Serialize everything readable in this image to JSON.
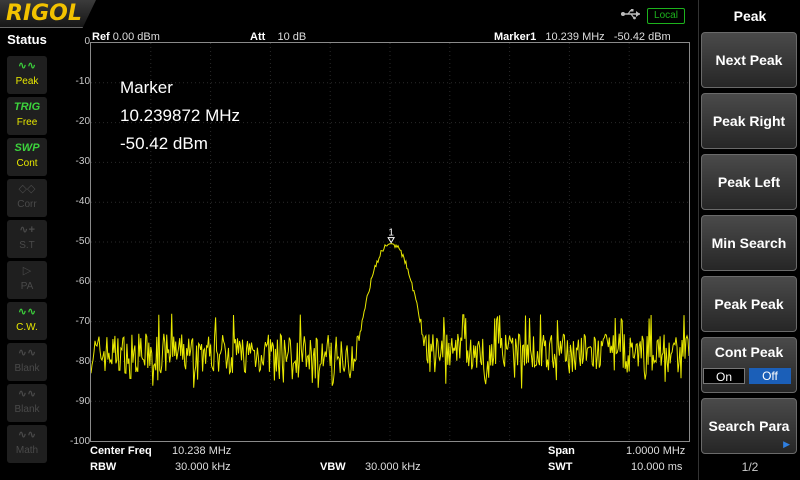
{
  "brand": "RIGOL",
  "top": {
    "local_label": "Local"
  },
  "status": {
    "title": "Status",
    "items": [
      {
        "glyph": "∿∿",
        "label": "Peak",
        "state": "on",
        "icon": "peak-icon"
      },
      {
        "glyph": "TRIG",
        "label": "Free",
        "state": "on",
        "icon": "trig-icon"
      },
      {
        "glyph": "SWP",
        "label": "Cont",
        "state": "on",
        "icon": "sweep-icon"
      },
      {
        "glyph": "◇◇",
        "label": "Corr",
        "state": "off",
        "icon": "correction-icon"
      },
      {
        "glyph": "∿+",
        "label": "S.T",
        "state": "off",
        "icon": "source-tracking-icon"
      },
      {
        "glyph": "▷",
        "label": "PA",
        "state": "off",
        "icon": "preamp-icon"
      },
      {
        "glyph": "∿∿",
        "label": "C.W.",
        "state": "on",
        "icon": "cw-icon"
      },
      {
        "glyph": "∿∿",
        "label": "Blank",
        "state": "off",
        "icon": "blank-icon"
      },
      {
        "glyph": "∿∿",
        "label": "Blank",
        "state": "off",
        "icon": "blank-icon"
      },
      {
        "glyph": "∿∿",
        "label": "Math",
        "state": "off",
        "icon": "math-icon"
      }
    ]
  },
  "header": {
    "ref_label": "Ref",
    "ref_value": "0.00 dBm",
    "att_label": "Att",
    "att_value": "10 dB",
    "marker_label": "Marker1",
    "marker_freq": "10.239 MHz",
    "marker_amp": "-50.42 dBm"
  },
  "marker_readout": {
    "title": "Marker",
    "freq": "10.239872 MHz",
    "amp": "-50.42 dBm",
    "tag": "1"
  },
  "y_ticks": [
    "0",
    "-10",
    "-20",
    "-30",
    "-40",
    "-50",
    "-60",
    "-70",
    "-80",
    "-90",
    "-100"
  ],
  "footer": {
    "center_label": "Center Freq",
    "center_value": "10.238 MHz",
    "span_label": "Span",
    "span_value": "1.0000 MHz",
    "rbw_label": "RBW",
    "rbw_value": "30.000 kHz",
    "vbw_label": "VBW",
    "vbw_value": "30.000 kHz",
    "swt_label": "SWT",
    "swt_value": "10.000 ms"
  },
  "menu": {
    "title": "Peak",
    "keys": [
      "Next Peak",
      "Peak Right",
      "Peak Left",
      "Min Search",
      "Peak Peak",
      "",
      "Search Para"
    ],
    "cont_peak": {
      "label": "Cont Peak",
      "on": "On",
      "off": "Off",
      "selected": "Off"
    },
    "page": "1/2"
  },
  "chart_data": {
    "type": "line",
    "title": "",
    "xlabel": "",
    "ylabel": "",
    "ylim": [
      -100,
      0
    ],
    "x_units": "MHz",
    "xlim": [
      9.738,
      10.738
    ],
    "noise_floor": -78,
    "noise_range": [
      -87,
      -68
    ],
    "peak_x": 10.239872,
    "peak_y": -50.42,
    "peak_width_mhz": 0.06,
    "color": "#e8e800"
  }
}
